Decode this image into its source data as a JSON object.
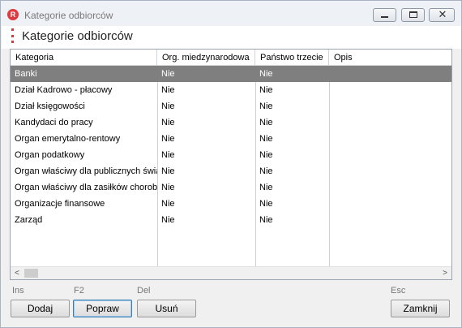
{
  "window": {
    "title": "Kategorie odbiorców",
    "logo_letter": "R",
    "accent_color": "#e03a3e",
    "controls": {
      "minimize_icon": "minimize-icon",
      "maximize_icon": "maximize-icon",
      "close_glyph": "✕"
    }
  },
  "page": {
    "title": "Kategorie odbiorców"
  },
  "table": {
    "columns": [
      "Kategoria",
      "Org. miedzynarodowa",
      "Państwo trzecie",
      "Opis"
    ],
    "rows": [
      [
        "Banki",
        "Nie",
        "Nie",
        ""
      ],
      [
        "Dział Kadrowo - płacowy",
        "Nie",
        "Nie",
        ""
      ],
      [
        "Dział księgowości",
        "Nie",
        "Nie",
        ""
      ],
      [
        "Kandydaci do pracy",
        "Nie",
        "Nie",
        ""
      ],
      [
        "Organ emerytalno-rentowy",
        "Nie",
        "Nie",
        ""
      ],
      [
        "Organ podatkowy",
        "Nie",
        "Nie",
        ""
      ],
      [
        "Organ właściwy dla publicznych świadczeń",
        "Nie",
        "Nie",
        ""
      ],
      [
        "Organ właściwy dla zasiłków chorobowych",
        "Nie",
        "Nie",
        ""
      ],
      [
        "Organizacje finansowe",
        "Nie",
        "Nie",
        ""
      ],
      [
        "Zarząd",
        "Nie",
        "Nie",
        ""
      ]
    ],
    "selected_row": 0,
    "selected_color": "#7f7f7f",
    "scroll_left_glyph": "<",
    "scroll_right_glyph": ">"
  },
  "buttons": {
    "add": {
      "label": "Dodaj",
      "shortcut": "Ins"
    },
    "edit": {
      "label": "Popraw",
      "shortcut": "F2"
    },
    "delete": {
      "label": "Usuń",
      "shortcut": "Del"
    },
    "close": {
      "label": "Zamknij",
      "shortcut": "Esc"
    }
  }
}
